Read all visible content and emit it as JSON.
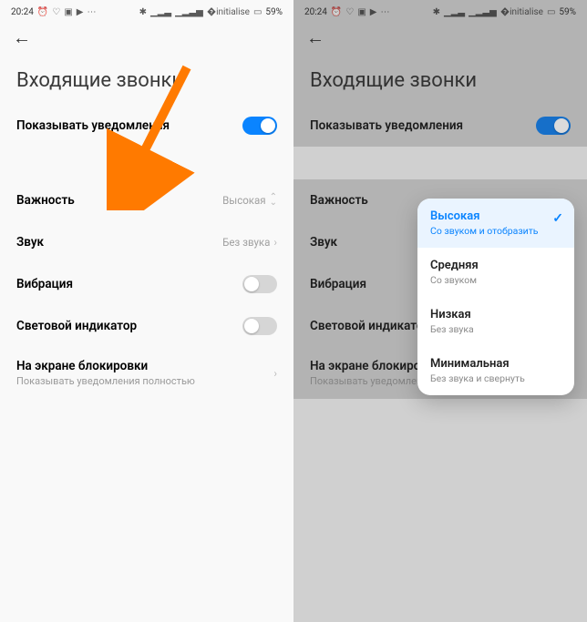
{
  "status": {
    "time": "20:24",
    "battery": "59%"
  },
  "title": "Входящие звонки",
  "show_notif_label": "Показывать уведомления",
  "rows": {
    "importance": {
      "label": "Важность",
      "value": "Высокая"
    },
    "sound": {
      "label": "Звук",
      "value": "Без звука"
    },
    "vibration": {
      "label": "Вибрация"
    },
    "led": {
      "label": "Световой индикатор"
    },
    "lockscreen": {
      "label": "На экране блокировки",
      "sub": "Показывать уведомления полностью"
    }
  },
  "popup": {
    "items": [
      {
        "title": "Высокая",
        "sub": "Со звуком и отобразить",
        "selected": true
      },
      {
        "title": "Средняя",
        "sub": "Со звуком",
        "selected": false
      },
      {
        "title": "Низкая",
        "sub": "Без звука",
        "selected": false
      },
      {
        "title": "Минимальная",
        "sub": "Без звука и свернуть",
        "selected": false
      }
    ]
  }
}
